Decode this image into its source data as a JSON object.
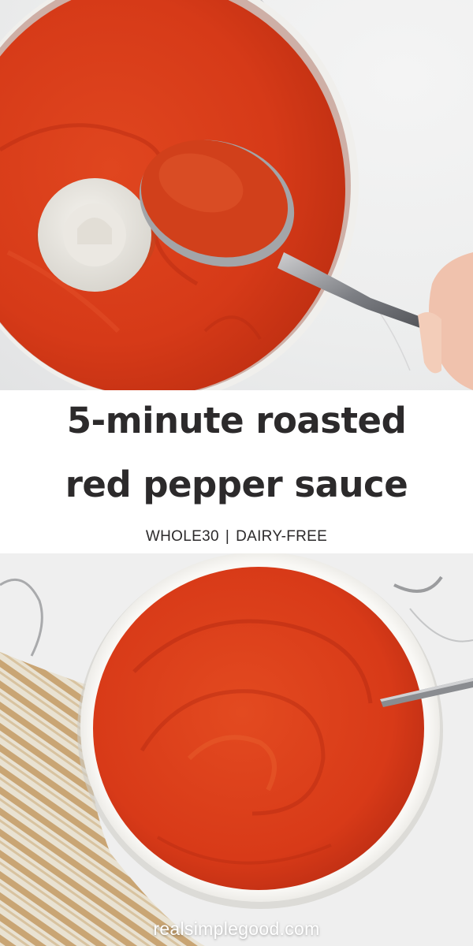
{
  "title": {
    "line1": "5-minute roasted",
    "line2": "red pepper sauce"
  },
  "tags": {
    "left": "WHOLE30",
    "separator": "|",
    "right": "DAIRY-FREE"
  },
  "website": "realsimplegood.com",
  "colors": {
    "sauce": "#d9391c",
    "sauce_dark": "#b52a12",
    "text": "#2c2a2b",
    "marble": "#eeeeee",
    "bowl": "#f7f6f3"
  }
}
